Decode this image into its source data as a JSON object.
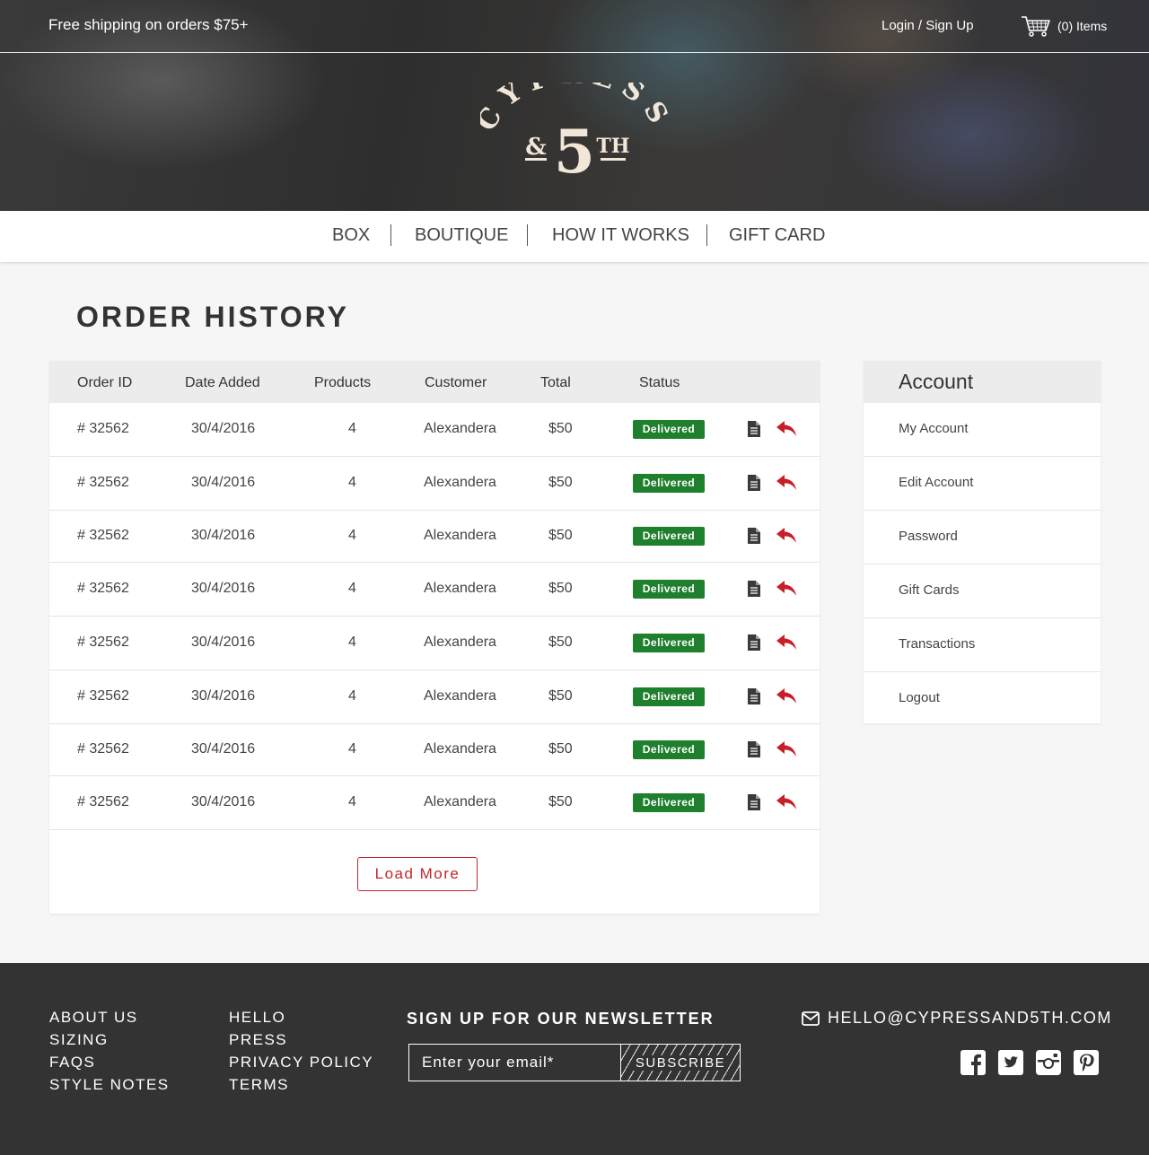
{
  "topbar": {
    "shipping_text": "Free shipping on orders $75+",
    "login_label": "Login / Sign Up",
    "cart_label": "(0) Items"
  },
  "logo": {
    "alt": "Cypress & 5th",
    "line1": "CYPRESS",
    "amp": "&",
    "five": "5",
    "th": "TH"
  },
  "nav": {
    "items": [
      "BOX",
      "BOUTIQUE",
      "HOW IT WORKS",
      "GIFT CARD"
    ]
  },
  "page": {
    "title": "ORDER HISTORY"
  },
  "orders": {
    "columns": [
      "Order ID",
      "Date Added",
      "Products",
      "Customer",
      "Total",
      "Status"
    ],
    "rows": [
      {
        "id": "# 32562",
        "date": "30/4/2016",
        "products": "4",
        "customer": "Alexandera",
        "total": "$50",
        "status": "Delivered"
      },
      {
        "id": "# 32562",
        "date": "30/4/2016",
        "products": "4",
        "customer": "Alexandera",
        "total": "$50",
        "status": "Delivered"
      },
      {
        "id": "# 32562",
        "date": "30/4/2016",
        "products": "4",
        "customer": "Alexandera",
        "total": "$50",
        "status": "Delivered"
      },
      {
        "id": "# 32562",
        "date": "30/4/2016",
        "products": "4",
        "customer": "Alexandera",
        "total": "$50",
        "status": "Delivered"
      },
      {
        "id": "# 32562",
        "date": "30/4/2016",
        "products": "4",
        "customer": "Alexandera",
        "total": "$50",
        "status": "Delivered"
      },
      {
        "id": "# 32562",
        "date": "30/4/2016",
        "products": "4",
        "customer": "Alexandera",
        "total": "$50",
        "status": "Delivered"
      },
      {
        "id": "# 32562",
        "date": "30/4/2016",
        "products": "4",
        "customer": "Alexandera",
        "total": "$50",
        "status": "Delivered"
      },
      {
        "id": "# 32562",
        "date": "30/4/2016",
        "products": "4",
        "customer": "Alexandera",
        "total": "$50",
        "status": "Delivered"
      }
    ],
    "row_icons": [
      "document-icon",
      "reply-icon"
    ],
    "load_more_label": "Load More"
  },
  "account": {
    "title": "Account",
    "items": [
      "My Account",
      "Edit Account",
      "Password",
      "Gift Cards",
      "Transactions",
      "Logout"
    ]
  },
  "footer": {
    "col1": [
      "ABOUT US",
      "SIZING",
      "FAQS",
      "STYLE NOTES"
    ],
    "col2": [
      "HELLO",
      "PRESS",
      "PRIVACY POLICY",
      "TERMS"
    ],
    "newsletter_title": "SIGN UP FOR OUR NEWSLETTER",
    "email_placeholder": "Enter your email*",
    "subscribe_label": "SUBSCRIBE",
    "contact_email": "HELLO@CYPRESSAND5TH.COM",
    "social_icons": [
      "facebook-icon",
      "twitter-icon",
      "instagram-icon",
      "pinterest-icon"
    ]
  },
  "colors": {
    "accent_red": "#c0282d",
    "status_green": "#1e7f2d",
    "footer_bg": "#333333",
    "logo_cream": "#f2e6d8"
  }
}
